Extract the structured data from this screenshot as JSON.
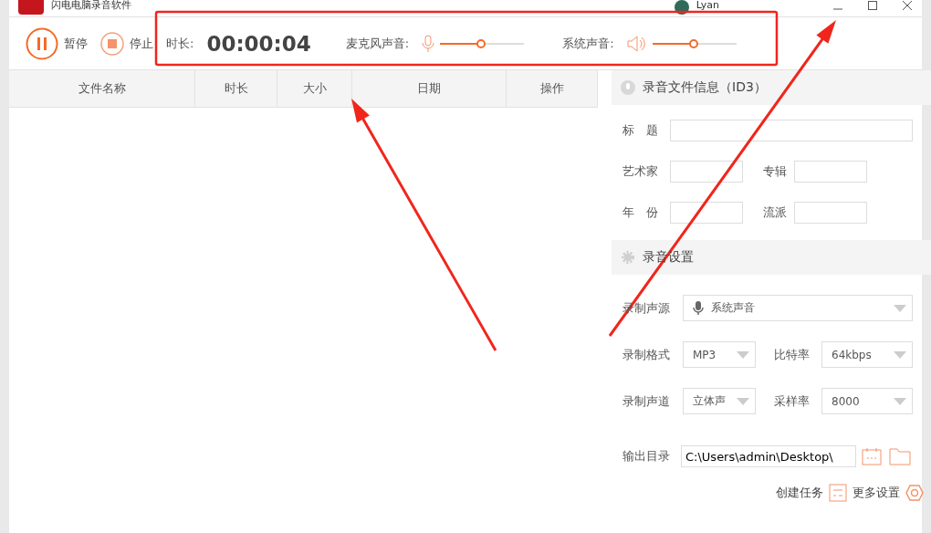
{
  "window": {
    "title": "闪电电脑录音软件",
    "user": "Lyan"
  },
  "toolbar": {
    "pause": "暂停",
    "stop": "停止",
    "duration_label": "时长:",
    "duration": "00:00:04",
    "mic": {
      "label": "麦克风声音:",
      "level": 0.49
    },
    "system": {
      "label": "系统声音:",
      "level": 0.49
    }
  },
  "table": {
    "columns": [
      "文件名称",
      "时长",
      "大小",
      "日期",
      "操作"
    ]
  },
  "id3": {
    "title": "录音文件信息（ID3）",
    "fields": [
      {
        "label": "标　题"
      },
      {
        "label": "艺术家"
      },
      {
        "label": "专辑"
      },
      {
        "label": "年　份"
      },
      {
        "label": "流派"
      }
    ]
  },
  "settings": {
    "title": "录音设置",
    "source_label": "录制声源",
    "source": "系统声音",
    "selects": [
      {
        "label": "录制格式",
        "value": "MP3"
      },
      {
        "label": "比特率",
        "value": "64kbps"
      },
      {
        "label": "录制声道",
        "value": "立体声"
      },
      {
        "label": "采样率",
        "value": "8000"
      }
    ],
    "output_label": "输出目录",
    "output": "C:\\Users\\admin\\Desktop\\",
    "create_task": "创建任务",
    "more_settings": "更多设置"
  }
}
